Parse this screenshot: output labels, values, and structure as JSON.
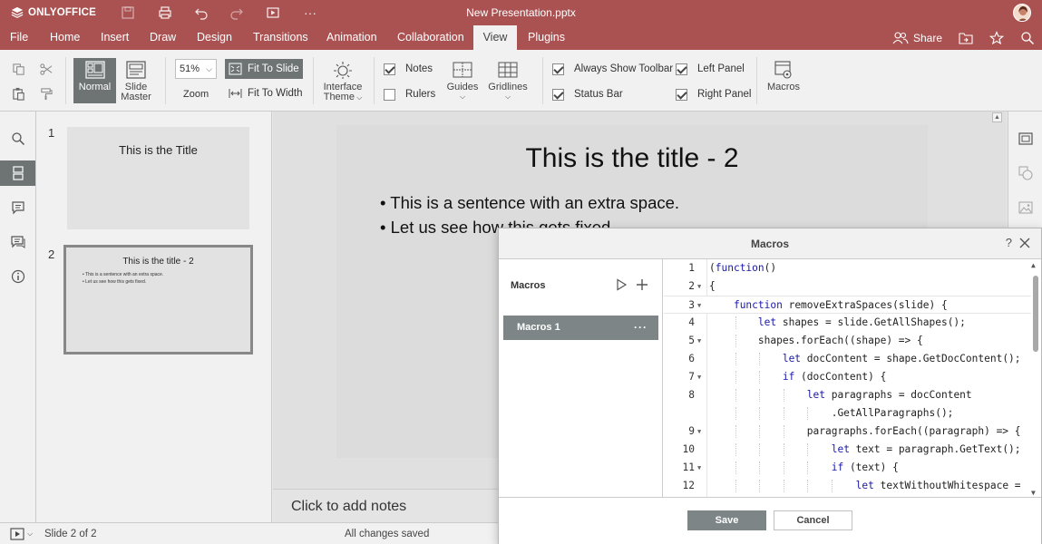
{
  "app": {
    "name": "ONLYOFFICE",
    "doc_title": "New Presentation.pptx"
  },
  "colors": {
    "brand": "#aa5252",
    "active_button": "#6e7474",
    "panel": "#f1f1f1"
  },
  "tabs": [
    "File",
    "Home",
    "Insert",
    "Draw",
    "Design",
    "Transitions",
    "Animation",
    "Collaboration",
    "View",
    "Plugins"
  ],
  "active_tab": "View",
  "header_right": {
    "share_label": "Share"
  },
  "toolbar": {
    "normal_label": "Normal",
    "slide_master_label": "Slide\nMaster",
    "zoom_value": "51%",
    "zoom_label": "Zoom",
    "fit_to_slide_label": "Fit To Slide",
    "fit_to_width_label": "Fit To Width",
    "interface_theme_label": "Interface\nTheme",
    "notes_label": "Notes",
    "rulers_label": "Rulers",
    "guides_label": "Guides",
    "gridlines_label": "Gridlines",
    "always_show_toolbar_label": "Always Show Toolbar",
    "status_bar_label": "Status Bar",
    "left_panel_label": "Left Panel",
    "right_panel_label": "Right Panel",
    "macros_label": "Macros",
    "checks": {
      "notes": true,
      "rulers": false,
      "always_show_toolbar": true,
      "status_bar": true,
      "left_panel": true,
      "right_panel": true
    }
  },
  "thumbnails": [
    {
      "number": "1",
      "title": "This is the Title"
    },
    {
      "number": "2",
      "title": "This is the title - 2",
      "bullets": [
        "• This is a sentence with an extra space.",
        "• Let us see how this gets fixed."
      ]
    }
  ],
  "slide": {
    "title": "This is the title - 2",
    "bullets": [
      "• This is a sentence with an extra space.",
      "• Let us see how this gets fixed."
    ]
  },
  "notes_placeholder": "Click to add notes",
  "statusbar": {
    "slide_info": "Slide 2 of 2",
    "save_state": "All changes saved"
  },
  "macros_dialog": {
    "title": "Macros",
    "help": "?",
    "list_title": "Macros",
    "items": [
      {
        "name": "Macros 1"
      }
    ],
    "code_lines": [
      {
        "n": "1",
        "fold": false,
        "text": "(function()"
      },
      {
        "n": "2",
        "fold": true,
        "text": "{"
      },
      {
        "n": "3",
        "fold": true,
        "text": "    function removeExtraSpaces(slide) {"
      },
      {
        "n": "4",
        "fold": false,
        "text": "        let shapes = slide.GetAllShapes();"
      },
      {
        "n": "5",
        "fold": true,
        "text": "        shapes.forEach((shape) => {"
      },
      {
        "n": "6",
        "fold": false,
        "text": "            let docContent = shape.GetDocContent();"
      },
      {
        "n": "7",
        "fold": true,
        "text": "            if (docContent) {"
      },
      {
        "n": "8",
        "fold": false,
        "text": "                let paragraphs = docContent"
      },
      {
        "n": "",
        "fold": false,
        "text": "                    .GetAllParagraphs();"
      },
      {
        "n": "9",
        "fold": true,
        "text": "                paragraphs.forEach((paragraph) => {"
      },
      {
        "n": "10",
        "fold": false,
        "text": "                    let text = paragraph.GetText();"
      },
      {
        "n": "11",
        "fold": true,
        "text": "                    if (text) {"
      },
      {
        "n": "12",
        "fold": false,
        "text": "                        let textWithoutWhitespace ="
      }
    ],
    "save_label": "Save",
    "cancel_label": "Cancel"
  }
}
